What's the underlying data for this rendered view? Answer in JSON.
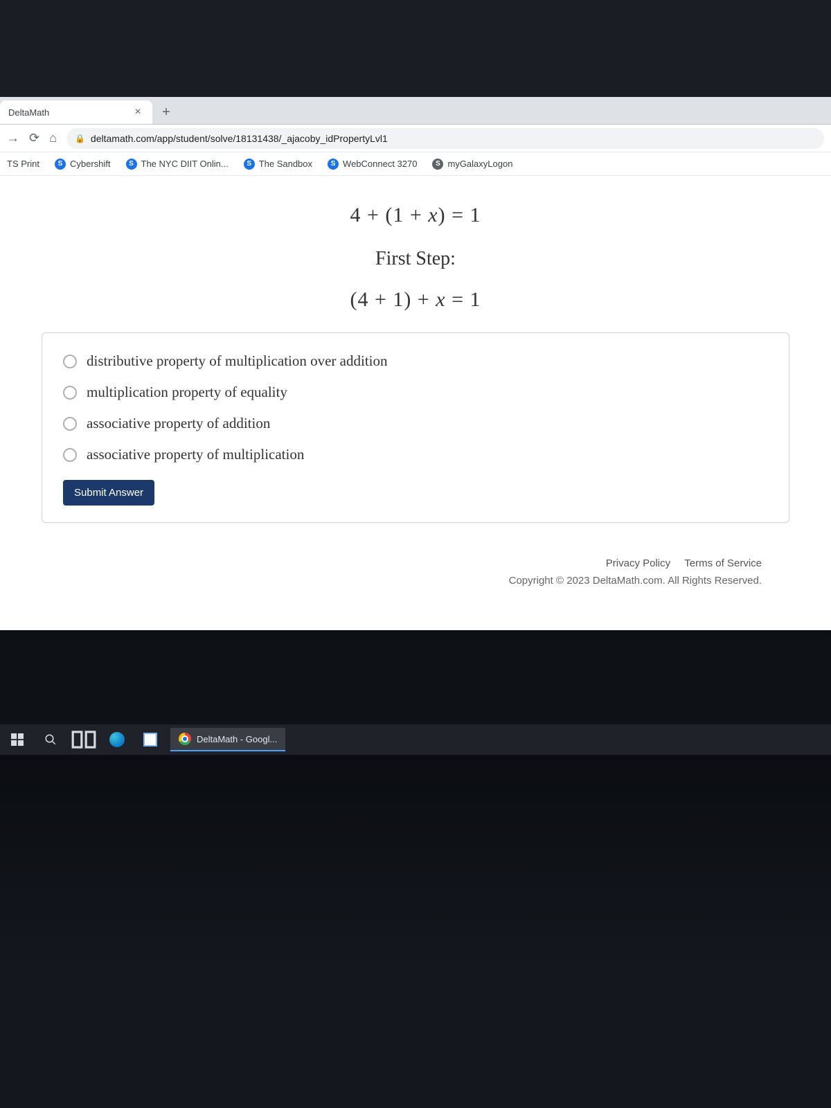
{
  "browser": {
    "tab_title": "DeltaMath",
    "url_display": "deltamath.com/app/student/solve/18131438/_ajacoby_idPropertyLvl1",
    "bookmarks": [
      {
        "label": "TS Print"
      },
      {
        "label": "Cybershift"
      },
      {
        "label": "The NYC DIIT Onlin..."
      },
      {
        "label": "The Sandbox"
      },
      {
        "label": "WebConnect 3270"
      },
      {
        "label": "myGalaxyLogon"
      }
    ]
  },
  "problem": {
    "equation": "4 + (1 + x) = 1",
    "step_label": "First Step:",
    "step_equation": "(4 + 1) + x = 1",
    "options": [
      "distributive property of multiplication over addition",
      "multiplication property of equality",
      "associative property of addition",
      "associative property of multiplication"
    ],
    "submit_label": "Submit Answer"
  },
  "footer": {
    "privacy": "Privacy Policy",
    "terms": "Terms of Service",
    "copyright": "Copyright © 2023 DeltaMath.com. All Rights Reserved."
  },
  "taskbar": {
    "app_label": "DeltaMath - Googl..."
  }
}
